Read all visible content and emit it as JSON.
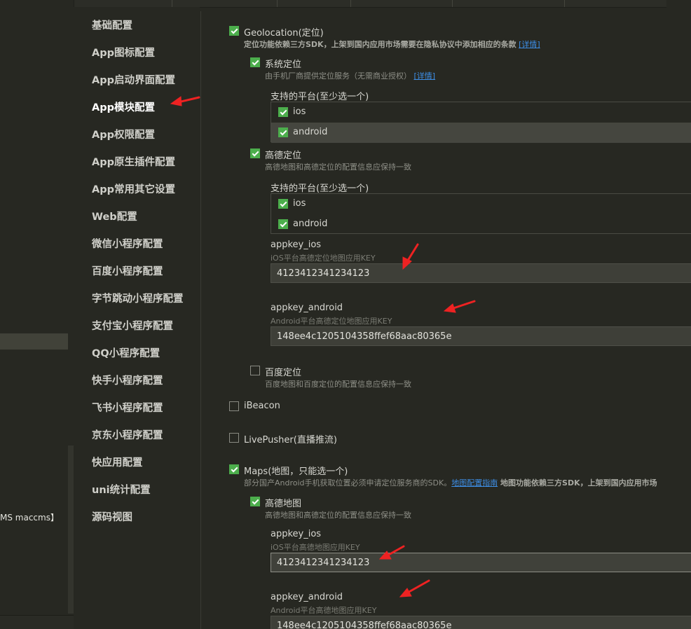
{
  "explorer": {
    "visible_text": "MS maccms】"
  },
  "nav": {
    "items": [
      {
        "label": "基础配置"
      },
      {
        "label": "App图标配置"
      },
      {
        "label": "App启动界面配置"
      },
      {
        "label": "App模块配置"
      },
      {
        "label": "App权限配置"
      },
      {
        "label": "App原生插件配置"
      },
      {
        "label": "App常用其它设置"
      },
      {
        "label": "Web配置"
      },
      {
        "label": "微信小程序配置"
      },
      {
        "label": "百度小程序配置"
      },
      {
        "label": "字节跳动小程序配置"
      },
      {
        "label": "支付宝小程序配置"
      },
      {
        "label": "QQ小程序配置"
      },
      {
        "label": "快手小程序配置"
      },
      {
        "label": "飞书小程序配置"
      },
      {
        "label": "京东小程序配置"
      },
      {
        "label": "快应用配置"
      },
      {
        "label": "uni统计配置"
      },
      {
        "label": "源码视图"
      }
    ],
    "active_index": 3
  },
  "geolocation": {
    "checked": true,
    "label": "Geolocation(定位)",
    "desc_text": "定位功能依赖三方SDK，上架到国内应用市场需要在隐私协议中添加相应的条款",
    "desc_link": "[详情]",
    "system": {
      "checked": true,
      "label": "系统定位",
      "desc_text": "由手机厂商提供定位服务（无需商业授权）",
      "desc_link": "[详情]",
      "platform_title": "支持的平台(至少选一个)",
      "platforms": [
        {
          "name": "ios",
          "checked": true
        },
        {
          "name": "android",
          "checked": true
        }
      ]
    },
    "amap": {
      "checked": true,
      "label": "高德定位",
      "desc": "高德地图和高德定位的配置信息应保持一致",
      "platform_title": "支持的平台(至少选一个)",
      "platforms": [
        {
          "name": "ios",
          "checked": true
        },
        {
          "name": "android",
          "checked": true
        }
      ],
      "appkey_ios": {
        "label": "appkey_ios",
        "desc": "iOS平台高德定位地图应用KEY",
        "value": "4123412341234123"
      },
      "appkey_android": {
        "label": "appkey_android",
        "desc": "Android平台高德定位地图应用KEY",
        "value": "148ee4c1205104358ffef68aac80365e"
      }
    },
    "baidu": {
      "checked": false,
      "label": "百度定位",
      "desc": "百度地图和百度定位的配置信息应保持一致"
    }
  },
  "ibeacon": {
    "checked": false,
    "label": "iBeacon"
  },
  "livepusher": {
    "checked": false,
    "label": "LivePusher(直播推流)"
  },
  "maps": {
    "checked": true,
    "label": "Maps(地图，只能选一个)",
    "desc_text": "部分国产Android手机获取位置必须申请定位服务商的SDK。",
    "desc_link": "地图配置指南",
    "desc_bold": " 地图功能依赖三方SDK，上架到国内应用市场",
    "amap": {
      "checked": true,
      "label": "高德地图",
      "desc": "高德地图和高德定位的配置信息应保持一致",
      "appkey_ios": {
        "label": "appkey_ios",
        "desc": "iOS平台高德地图应用KEY",
        "value": "4123412341234123"
      },
      "appkey_android": {
        "label": "appkey_android",
        "desc": "Android平台高德地图应用KEY",
        "value": "148ee4c1205104358ffef68aac80365e"
      }
    }
  },
  "colors": {
    "background": "#272822",
    "checkbox_checked": "#4cae4c",
    "link": "#3d8ee6",
    "annotation_arrow": "#ee2222"
  },
  "icons": {
    "checkbox_checked": "checkmark-icon",
    "annotation": "red-arrow-icon"
  }
}
